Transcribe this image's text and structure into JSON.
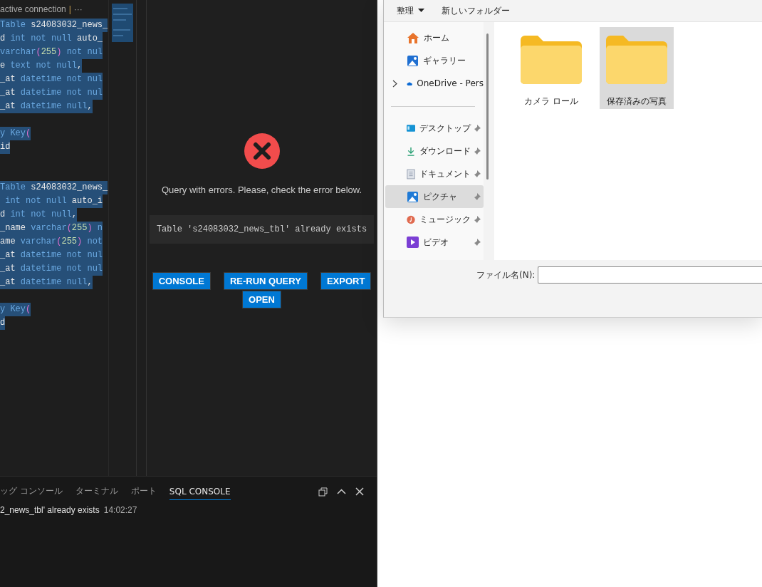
{
  "editor": {
    "header": {
      "connection": "active connection",
      "separator": "|",
      "more": "···"
    },
    "lines": [
      {
        "kind": "code",
        "tokens": [
          {
            "text": "Table ",
            "kind": "kw"
          },
          {
            "text": "s24083032_news_",
            "kind": "id"
          }
        ]
      },
      {
        "kind": "code",
        "tokens": [
          {
            "text": "d ",
            "kind": "id"
          },
          {
            "text": "int not null ",
            "kind": "kw"
          },
          {
            "text": "auto_",
            "kind": "id"
          }
        ]
      },
      {
        "kind": "code",
        "tokens": [
          {
            "text": "varchar",
            "kind": "kw"
          },
          {
            "text": "(",
            "kind": "paren"
          },
          {
            "text": "255",
            "kind": "num"
          },
          {
            "text": ")",
            "kind": "paren"
          },
          {
            "text": " not nul",
            "kind": "kw"
          }
        ]
      },
      {
        "kind": "code",
        "tokens": [
          {
            "text": "e ",
            "kind": "id"
          },
          {
            "text": "text not null",
            "kind": "kw"
          },
          {
            "text": ",",
            "kind": "id"
          }
        ]
      },
      {
        "kind": "code",
        "tokens": [
          {
            "text": "_at ",
            "kind": "id"
          },
          {
            "text": "datetime not nul",
            "kind": "kw"
          }
        ]
      },
      {
        "kind": "code",
        "tokens": [
          {
            "text": "_at ",
            "kind": "id"
          },
          {
            "text": "datetime not nul",
            "kind": "kw"
          }
        ]
      },
      {
        "kind": "code",
        "tokens": [
          {
            "text": "_at ",
            "kind": "id"
          },
          {
            "text": "datetime null",
            "kind": "kw"
          },
          {
            "text": ",",
            "kind": "id"
          }
        ]
      },
      {
        "kind": "blank"
      },
      {
        "kind": "code",
        "tokens": [
          {
            "text": "y Key",
            "kind": "kw"
          },
          {
            "text": "(",
            "kind": "paren"
          }
        ]
      },
      {
        "kind": "code",
        "tokens": [
          {
            "text": "id",
            "kind": "id"
          }
        ]
      },
      {
        "kind": "blank"
      },
      {
        "kind": "blank"
      },
      {
        "kind": "code",
        "tokens": [
          {
            "text": "Table ",
            "kind": "kw"
          },
          {
            "text": "s24083032_news_",
            "kind": "id"
          }
        ]
      },
      {
        "kind": "code",
        "tokens": [
          {
            "text": " int not null ",
            "kind": "kw"
          },
          {
            "text": "auto_i",
            "kind": "id"
          }
        ]
      },
      {
        "kind": "code",
        "tokens": [
          {
            "text": "d ",
            "kind": "id"
          },
          {
            "text": "int not null",
            "kind": "kw"
          },
          {
            "text": ",",
            "kind": "id"
          }
        ]
      },
      {
        "kind": "code",
        "tokens": [
          {
            "text": "_name ",
            "kind": "id"
          },
          {
            "text": "varchar",
            "kind": "kw"
          },
          {
            "text": "(",
            "kind": "paren"
          },
          {
            "text": "255",
            "kind": "num"
          },
          {
            "text": ")",
            "kind": "paren"
          },
          {
            "text": " n",
            "kind": "kw"
          }
        ]
      },
      {
        "kind": "code",
        "tokens": [
          {
            "text": "ame ",
            "kind": "id"
          },
          {
            "text": "varchar",
            "kind": "kw"
          },
          {
            "text": "(",
            "kind": "paren"
          },
          {
            "text": "255",
            "kind": "num"
          },
          {
            "text": ")",
            "kind": "paren"
          },
          {
            "text": " not",
            "kind": "kw"
          }
        ]
      },
      {
        "kind": "code",
        "tokens": [
          {
            "text": "_at ",
            "kind": "id"
          },
          {
            "text": "datetime not nul",
            "kind": "kw"
          }
        ]
      },
      {
        "kind": "code",
        "tokens": [
          {
            "text": "_at ",
            "kind": "id"
          },
          {
            "text": "datetime not nul",
            "kind": "kw"
          }
        ]
      },
      {
        "kind": "code",
        "tokens": [
          {
            "text": "_at ",
            "kind": "id"
          },
          {
            "text": "datetime null",
            "kind": "kw"
          },
          {
            "text": ",",
            "kind": "id"
          }
        ]
      },
      {
        "kind": "blank"
      },
      {
        "kind": "code",
        "tokens": [
          {
            "text": "y Key",
            "kind": "kw"
          },
          {
            "text": "(",
            "kind": "paren"
          }
        ]
      },
      {
        "kind": "code",
        "tokens": [
          {
            "text": "d",
            "kind": "id"
          }
        ]
      }
    ]
  },
  "results": {
    "message": "Query with errors. Please, check the error below.",
    "error": "Table 's24083032_news_tbl' already exists",
    "buttons": [
      "CONSOLE",
      "RE-RUN QUERY",
      "EXPORT",
      "OPEN"
    ]
  },
  "panel": {
    "tabs": [
      {
        "label": "ッグ コンソール",
        "selected": false
      },
      {
        "label": "ターミナル",
        "selected": false
      },
      {
        "label": "ポート",
        "selected": false
      },
      {
        "label": "SQL CONSOLE",
        "selected": true
      }
    ],
    "output": {
      "text": "2_news_tbl' already exists",
      "time": "14:02:27"
    }
  },
  "file_dialog": {
    "toolbar": {
      "organize": "整理",
      "new_folder": "新しいフォルダー"
    },
    "nav": [
      {
        "label": "ホーム",
        "selected": false,
        "pinned": false,
        "expandable": false
      },
      {
        "label": "ギャラリー",
        "selected": false,
        "pinned": false,
        "expandable": false
      },
      {
        "label": "OneDrive - Pers",
        "selected": false,
        "pinned": false,
        "expandable": true
      },
      {
        "label": "デスクトップ",
        "selected": false,
        "pinned": true,
        "expandable": false
      },
      {
        "label": "ダウンロード",
        "selected": false,
        "pinned": true,
        "expandable": false
      },
      {
        "label": "ドキュメント",
        "selected": false,
        "pinned": true,
        "expandable": false
      },
      {
        "label": "ピクチャ",
        "selected": true,
        "pinned": true,
        "expandable": false
      },
      {
        "label": "ミュージック",
        "selected": false,
        "pinned": true,
        "expandable": false
      },
      {
        "label": "ビデオ",
        "selected": false,
        "pinned": true,
        "expandable": false
      }
    ],
    "folders": [
      {
        "name": "カメラ ロール",
        "selected": false
      },
      {
        "name": "保存済みの写真",
        "selected": true
      }
    ],
    "filename_label": "ファイル名(N):"
  }
}
